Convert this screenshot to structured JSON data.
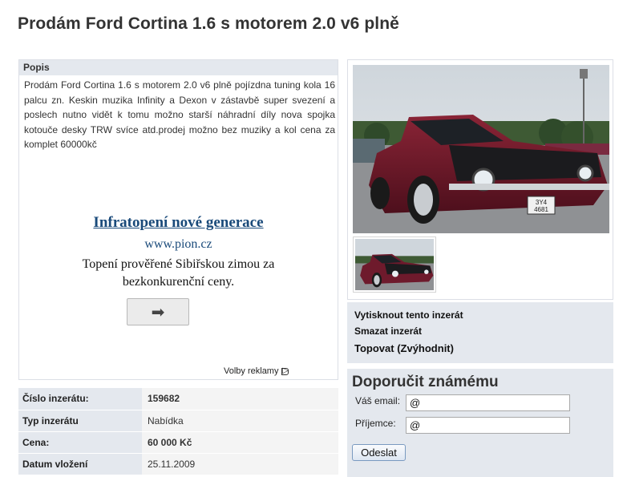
{
  "page_title": "Prodám Ford Cortina 1.6 s motorem 2.0 v6 plně",
  "description": {
    "heading": "Popis",
    "text": "Prodám Ford Cortina 1.6 s motorem 2.0 v6 plně pojízdna tuning kola 16 palcu zn. Keskin muzika Infinity a Dexon v zástavbě super svezení a poslech nutno vidět k tomu možno starší náhradní díly nova spojka kotouče desky TRW svíce atd.prodej možno bez muziky a kol cena za komplet 60000kč"
  },
  "ad": {
    "title": "Infratopení nové generace",
    "url": "www.pion.cz",
    "line1": "Topení prověřené Sibiřskou zimou za",
    "line2": "bezkonkurenční ceny.",
    "button_glyph": "➡",
    "choices_label": "Volby reklamy",
    "choices_glyph": "▷"
  },
  "info": [
    {
      "label": "Číslo inzerátu:",
      "value": "159682",
      "bold": true
    },
    {
      "label": "Typ inzerátu",
      "value": "Nabídka",
      "bold": false
    },
    {
      "label": "Cena:",
      "value": "60 000 Kč",
      "bold": true
    },
    {
      "label": "Datum vložení",
      "value": "25.11.2009",
      "bold": false
    }
  ],
  "photo": {
    "plate_line1": "3Y4",
    "plate_line2": "4681"
  },
  "actions": {
    "print": "Vytisknout tento inzerát",
    "delete": "Smazat inzerát",
    "top": "Topovat (Zvýhodnit)"
  },
  "recommend": {
    "title": "Doporučit známému",
    "email_label": "Váš email:",
    "email_value": "@",
    "recipient_label": "Příjemce:",
    "recipient_value": "@",
    "send_label": "Odeslat"
  },
  "colors": {
    "panel_bg": "#e4e8ee",
    "ad_link": "#1a4a7a",
    "car_body": "#7a1a2a"
  }
}
